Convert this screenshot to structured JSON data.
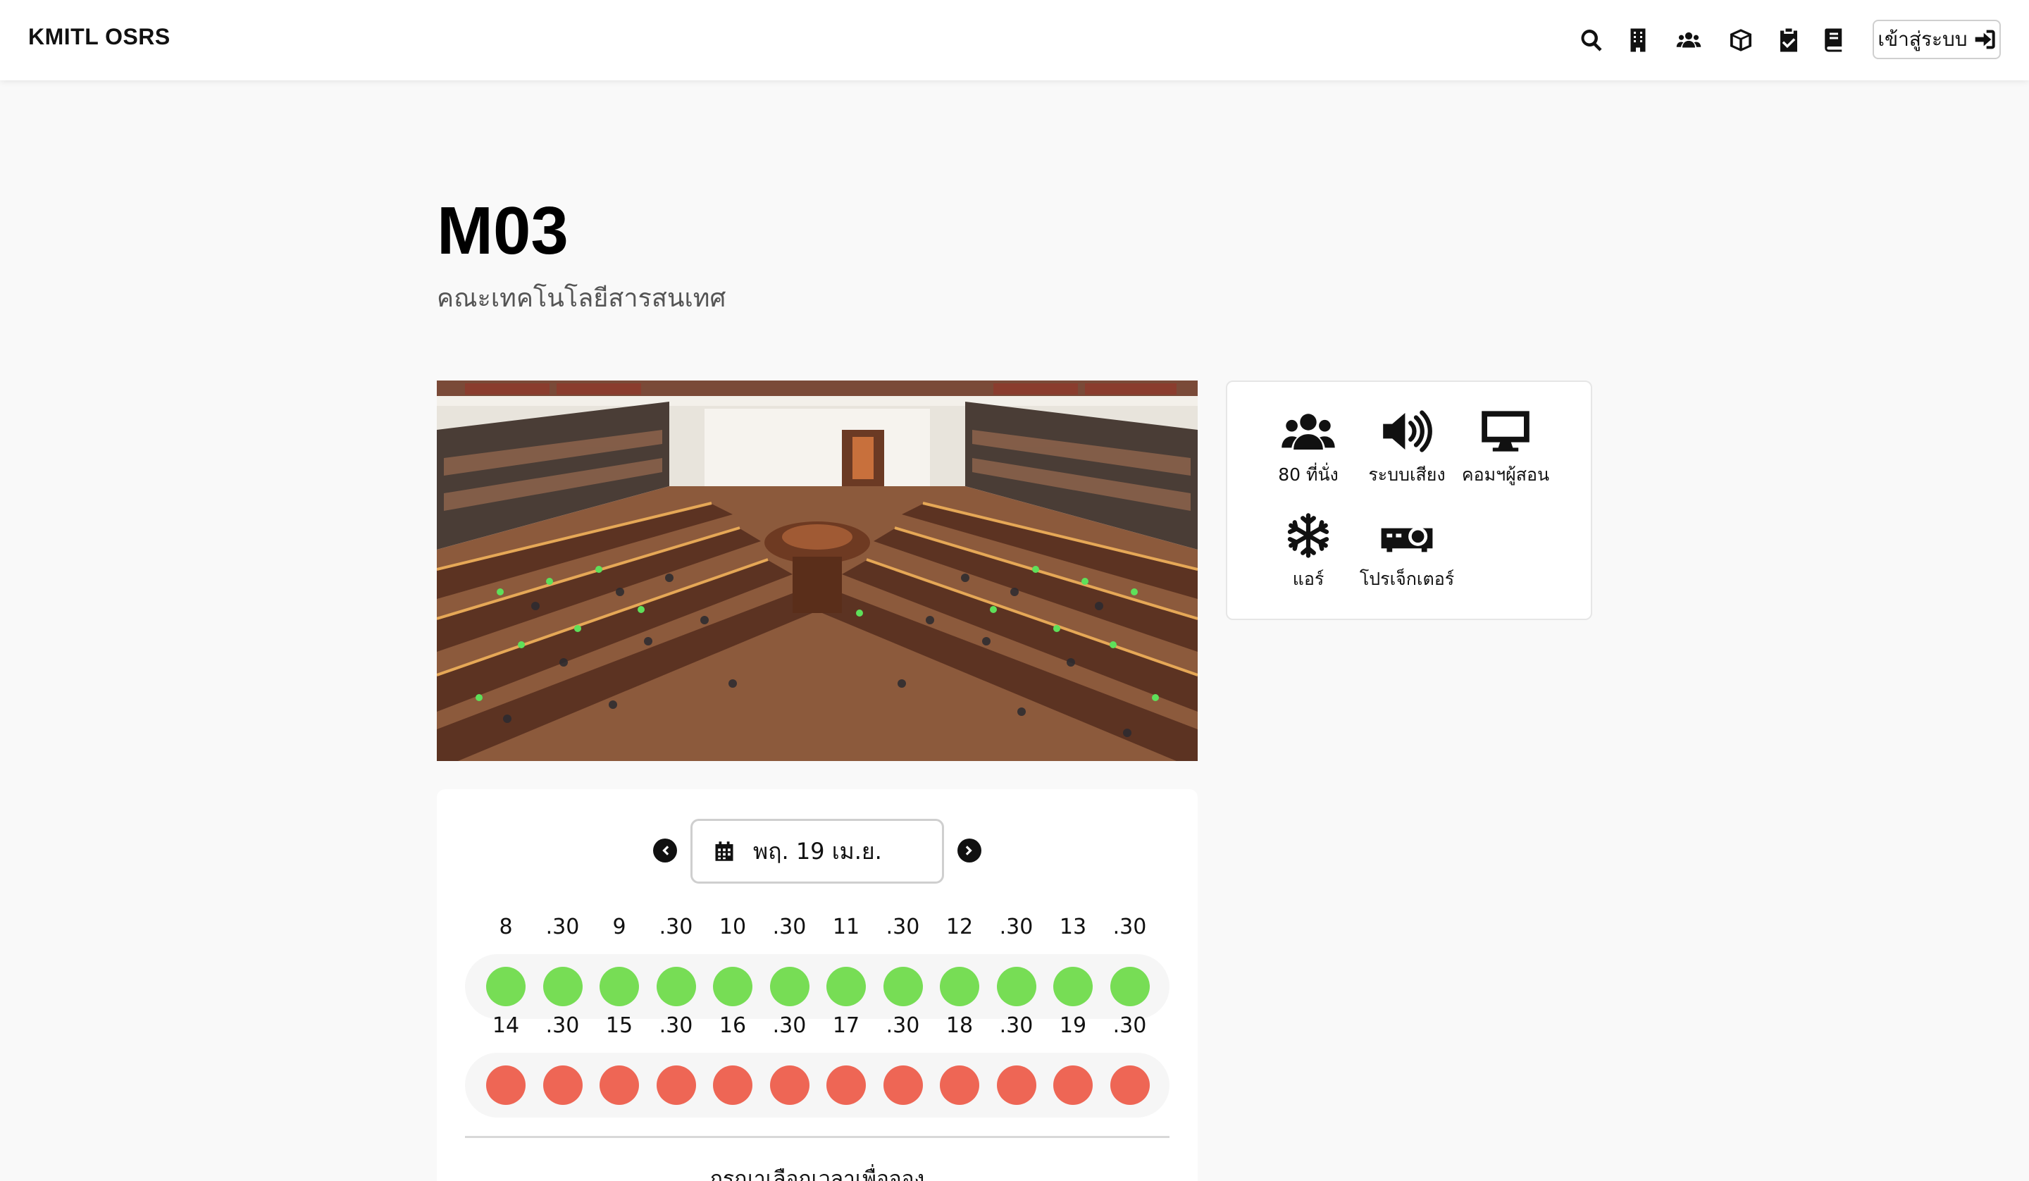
{
  "navbar": {
    "brand": "KMITL OSRS",
    "icons": [
      "search-icon",
      "building-icon",
      "users-icon",
      "box-icon",
      "clipboard-check-icon",
      "book-icon"
    ],
    "login_label": "เข้าสู่ระบบ"
  },
  "room": {
    "title": "M03",
    "faculty": "คณะเทคโนโลยีสารสนเทศ"
  },
  "features": [
    {
      "icon": "users-icon",
      "label": "80 ที่นั่ง"
    },
    {
      "icon": "speaker-icon",
      "label": "ระบบเสียง"
    },
    {
      "icon": "desktop-icon",
      "label": "คอมฯผู้สอน"
    },
    {
      "icon": "snowflake-icon",
      "label": "แอร์"
    },
    {
      "icon": "projector-icon",
      "label": "โปรเจ็กเตอร์"
    }
  ],
  "booking": {
    "date": "พฤ. 19 เม.ย.",
    "morning": {
      "labels": [
        "8",
        ".30",
        "9",
        ".30",
        "10",
        ".30",
        "11",
        ".30",
        "12",
        ".30",
        "13",
        ".30"
      ],
      "status": [
        "available",
        "available",
        "available",
        "available",
        "available",
        "available",
        "available",
        "available",
        "available",
        "available",
        "available",
        "available"
      ]
    },
    "afternoon": {
      "labels": [
        "14",
        ".30",
        "15",
        ".30",
        "16",
        ".30",
        "17",
        ".30",
        "18",
        ".30",
        "19",
        ".30"
      ],
      "status": [
        "booked",
        "booked",
        "booked",
        "booked",
        "booked",
        "booked",
        "booked",
        "booked",
        "booked",
        "booked",
        "booked",
        "booked"
      ]
    },
    "hint": "กรุณาเลือกเวลาเพื่อจอง"
  },
  "colors": {
    "available": "#77dd55",
    "booked": "#ee6655",
    "accent": "#111111"
  }
}
